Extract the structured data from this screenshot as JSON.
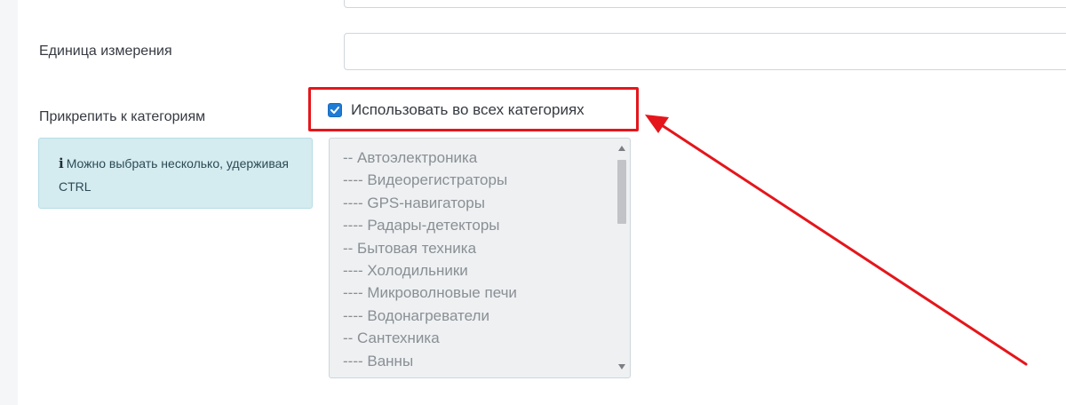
{
  "form": {
    "unit_label": "Единица измерения",
    "unit_value": "",
    "attach_label": "Прикрепить к категориям",
    "use_all_categories_label": "Использовать во всех категориях",
    "use_all_categories_checked": true,
    "info_icon": "info-icon",
    "info_text": "Можно выбрать несколько, удерживая CTRL",
    "categories": [
      "-- Автоэлектроника",
      "---- Видеорегистраторы",
      "---- GPS-навигаторы",
      "---- Радары-детекторы",
      "-- Бытовая техника",
      "---- Холодильники",
      "---- Микроволновые печи",
      "---- Водонагреватели",
      "-- Сантехника",
      "---- Ванны"
    ]
  },
  "annotation": {
    "highlight_color": "#e4161b",
    "arrow_color": "#e4161b"
  },
  "colors": {
    "checkbox_accent": "#1f7cd4",
    "info_background": "#d4ebf0",
    "disabled_select_background": "#eef0f2"
  }
}
